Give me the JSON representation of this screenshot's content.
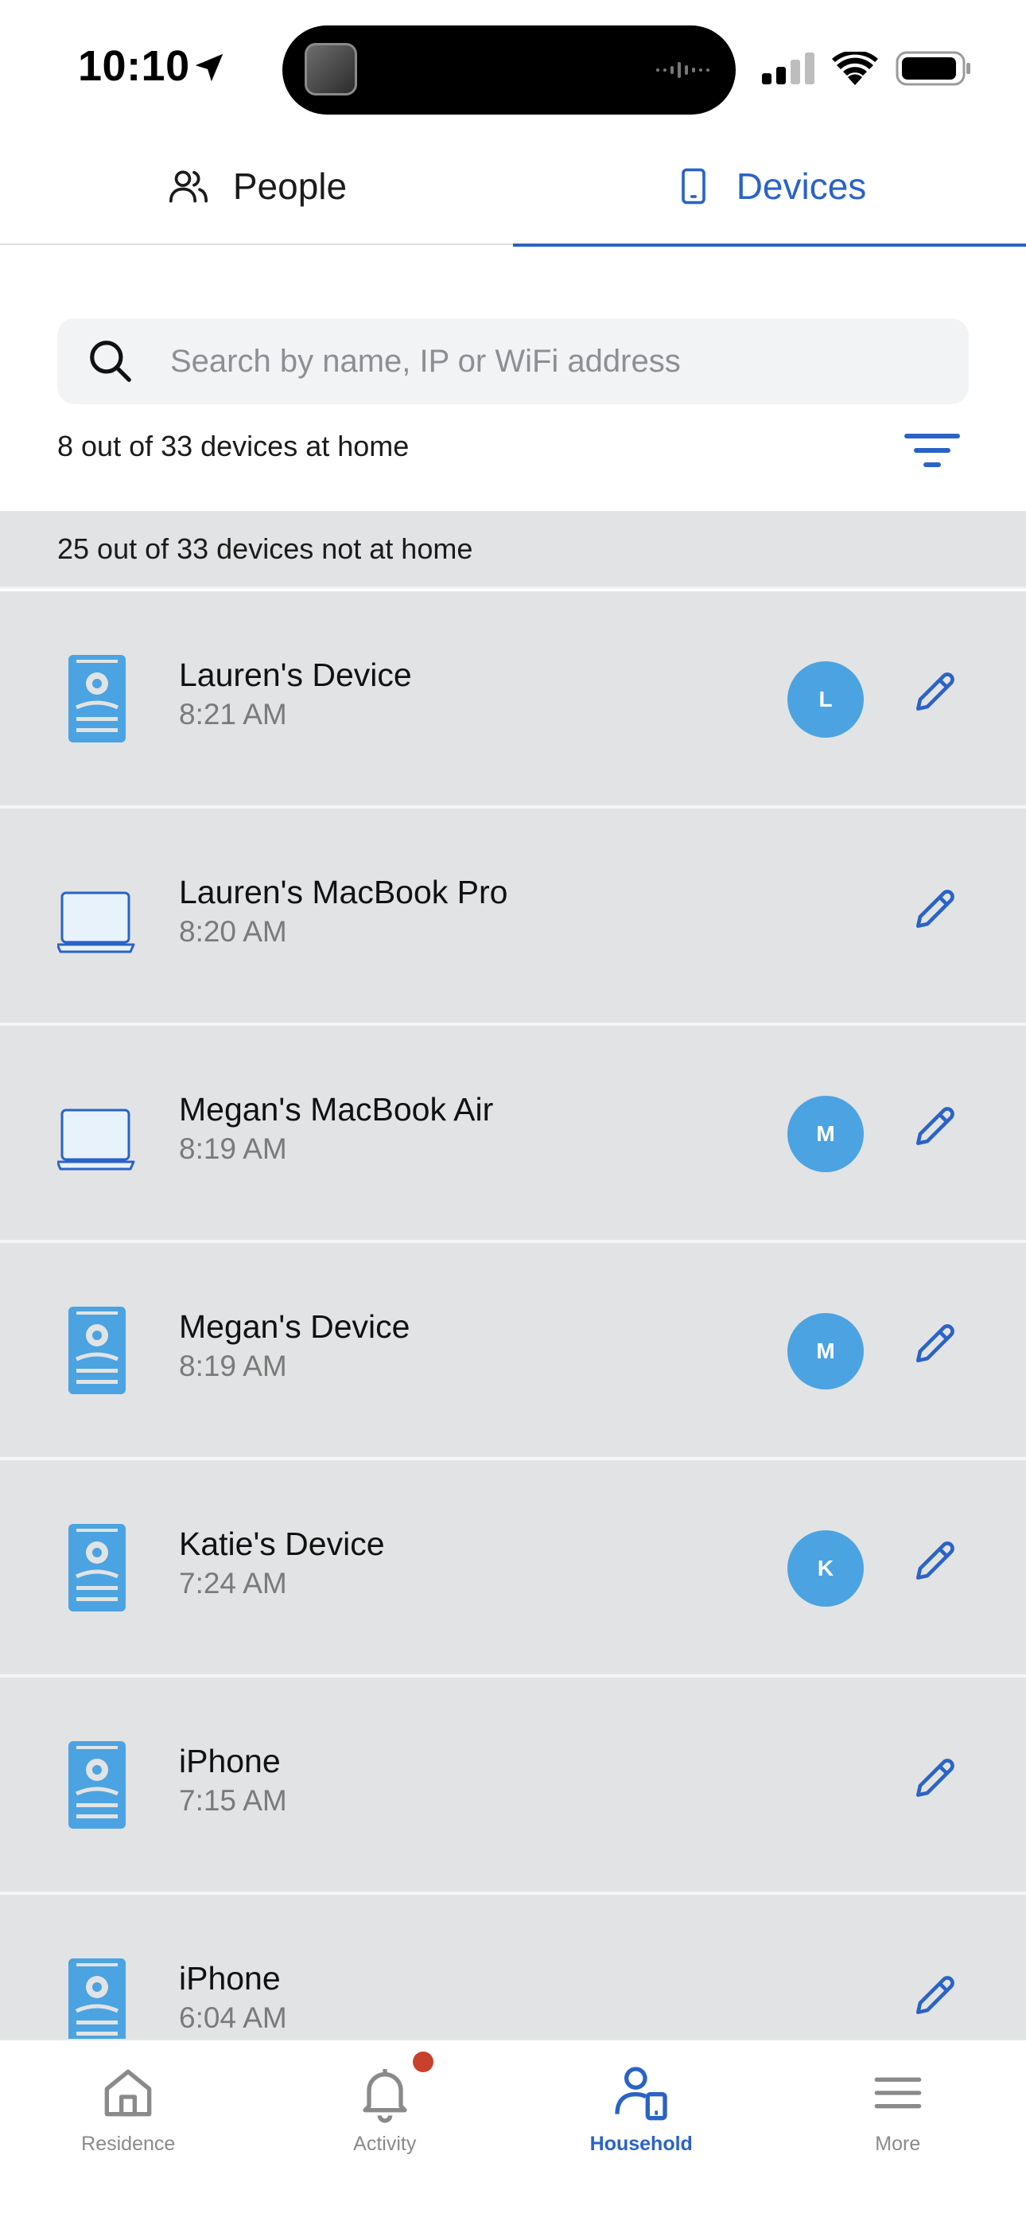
{
  "status_bar": {
    "time": "10:10",
    "icons": [
      "location-arrow-icon",
      "signal-icon",
      "wifi-icon",
      "battery-icon"
    ]
  },
  "tabs": [
    {
      "label": "People",
      "icon": "people-icon",
      "active": false
    },
    {
      "label": "Devices",
      "icon": "device-icon",
      "active": true
    }
  ],
  "colors": {
    "accent": "#2a63c7",
    "avatar": "#4ba3e2",
    "row_bg": "#e2e3e4",
    "badge": "#c8412b"
  },
  "search": {
    "placeholder": "Search by name, IP or WiFi address",
    "value": ""
  },
  "home_summary": "8 out of 33 devices at home",
  "away_summary": "25 out of 33 devices not at home",
  "devices": [
    {
      "name": "Lauren's Device",
      "time": "8:21 AM",
      "type": "phone",
      "avatar": "L"
    },
    {
      "name": "Lauren's MacBook Pro",
      "time": "8:20 AM",
      "type": "laptop",
      "avatar": ""
    },
    {
      "name": "Megan's MacBook Air",
      "time": "8:19 AM",
      "type": "laptop",
      "avatar": "M"
    },
    {
      "name": "Megan's Device",
      "time": "8:19 AM",
      "type": "phone",
      "avatar": "M"
    },
    {
      "name": "Katie's Device",
      "time": "7:24 AM",
      "type": "phone",
      "avatar": "K"
    },
    {
      "name": "iPhone",
      "time": "7:15 AM",
      "type": "phone",
      "avatar": ""
    },
    {
      "name": "iPhone",
      "time": "6:04 AM",
      "type": "phone",
      "avatar": ""
    }
  ],
  "bottom_nav": [
    {
      "label": "Residence",
      "icon": "home-icon",
      "active": false
    },
    {
      "label": "Activity",
      "icon": "bell-icon",
      "active": false,
      "badge": true
    },
    {
      "label": "Household",
      "icon": "household-icon",
      "active": true
    },
    {
      "label": "More",
      "icon": "menu-icon",
      "active": false
    }
  ]
}
